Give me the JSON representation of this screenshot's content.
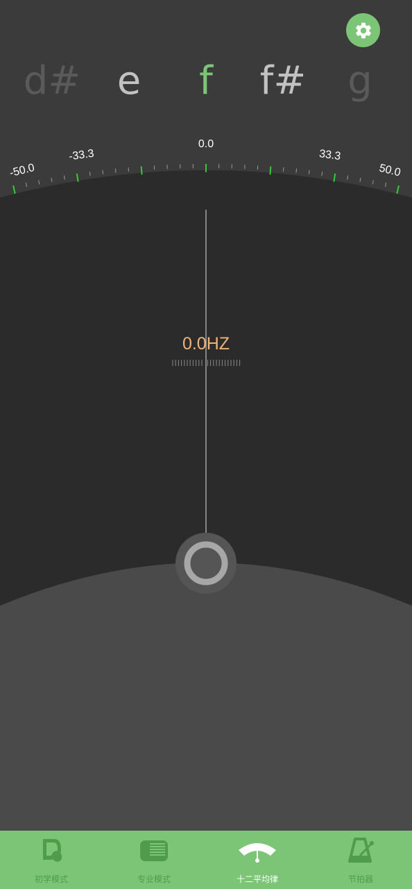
{
  "notes": [
    {
      "label": "d#",
      "color": "#5a5a5a"
    },
    {
      "label": "e",
      "color": "#c2c2c2"
    },
    {
      "label": "f",
      "color": "#7cc576"
    },
    {
      "label": "f#",
      "color": "#c2c2c2"
    },
    {
      "label": "g",
      "color": "#5a5a5a"
    }
  ],
  "scale": {
    "labels": [
      "-50.0",
      "-33.3",
      "0.0",
      "33.3",
      "50.0"
    ],
    "accent": "#37c93a"
  },
  "frequency": "0.0HZ",
  "nav": [
    {
      "label": "初学模式",
      "active": false
    },
    {
      "label": "专业模式",
      "active": false
    },
    {
      "label": "十二平均律",
      "active": true
    },
    {
      "label": "节拍器",
      "active": false
    }
  ],
  "colors": {
    "nav_bg": "#7cc576",
    "hz": "#f0b37a",
    "gauge_bg": "#2b2b2b",
    "lower_bg": "#4a4a4a"
  }
}
